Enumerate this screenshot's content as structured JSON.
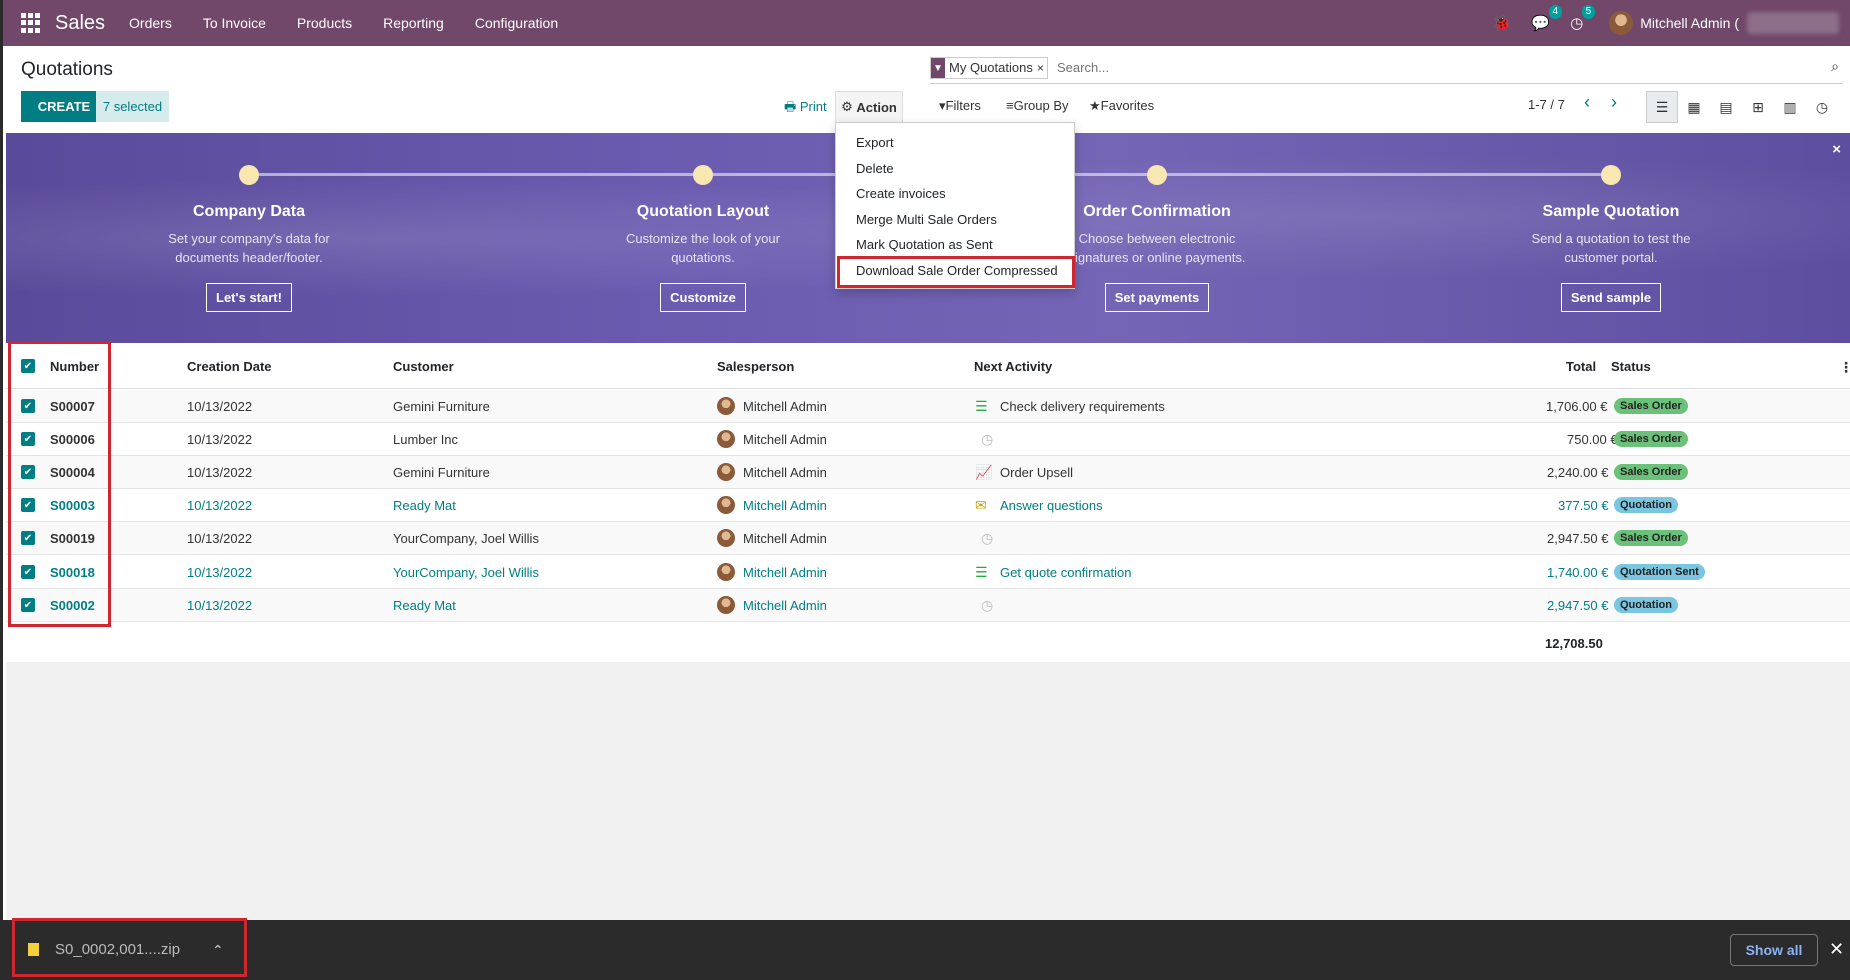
{
  "app": {
    "name": "Sales",
    "menu": [
      "Orders",
      "To Invoice",
      "Products",
      "Reporting",
      "Configuration"
    ]
  },
  "nav": {
    "messages_count": "4",
    "activities_count": "5",
    "user_name": "Mitchell Admin ("
  },
  "page": {
    "title": "Quotations",
    "create_label": "CREATE",
    "selected_label": "7 selected",
    "print_label": "Print",
    "action_label": "Action"
  },
  "action_menu": [
    "Export",
    "Delete",
    "Create invoices",
    "Merge Multi Sale Orders",
    "Mark Quotation as Sent",
    "Download Sale Order Compressed"
  ],
  "search": {
    "facet": "My Quotations",
    "placeholder": "Search..."
  },
  "filters": {
    "filters_label": "Filters",
    "groupby_label": "Group By",
    "favorites_label": "Favorites"
  },
  "pager": "1-7 / 7",
  "banner": {
    "steps": [
      {
        "title": "Company Data",
        "desc": "Set your company's data for documents header/footer.",
        "button": "Let's start!"
      },
      {
        "title": "Quotation Layout",
        "desc": "Customize the look of your quotations.",
        "button": "Customize"
      },
      {
        "title": "Order Confirmation",
        "desc": "Choose between electronic signatures or online payments.",
        "button": "Set payments"
      },
      {
        "title": "Sample Quotation",
        "desc": "Send a quotation to test the customer portal.",
        "button": "Send sample"
      }
    ]
  },
  "table": {
    "headers": {
      "number": "Number",
      "date": "Creation Date",
      "customer": "Customer",
      "salesperson": "Salesperson",
      "activity": "Next Activity",
      "total": "Total",
      "status": "Status"
    },
    "rows": [
      {
        "number": "S00007",
        "date": "10/13/2022",
        "customer": "Gemini Furniture",
        "salesperson": "Mitchell Admin",
        "activity": "Check delivery requirements",
        "activity_icon": "list-icon",
        "total": "1,706.00 €",
        "status": "Sales Order"
      },
      {
        "number": "S00006",
        "date": "10/13/2022",
        "customer": "Lumber Inc",
        "salesperson": "Mitchell Admin",
        "activity": "",
        "activity_icon": "clock-icon",
        "total": "750.00 €",
        "status": "Sales Order"
      },
      {
        "number": "S00004",
        "date": "10/13/2022",
        "customer": "Gemini Furniture",
        "salesperson": "Mitchell Admin",
        "activity": "Order Upsell",
        "activity_icon": "chart-icon",
        "total": "2,240.00 €",
        "status": "Sales Order"
      },
      {
        "number": "S00003",
        "date": "10/13/2022",
        "customer": "Ready Mat",
        "salesperson": "Mitchell Admin",
        "activity": "Answer questions",
        "activity_icon": "envelope-icon",
        "total": "377.50 €",
        "status": "Quotation"
      },
      {
        "number": "S00019",
        "date": "10/13/2022",
        "customer": "YourCompany, Joel Willis",
        "salesperson": "Mitchell Admin",
        "activity": "",
        "activity_icon": "clock-icon",
        "total": "2,947.50 €",
        "status": "Sales Order"
      },
      {
        "number": "S00018",
        "date": "10/13/2022",
        "customer": "YourCompany, Joel Willis",
        "salesperson": "Mitchell Admin",
        "activity": "Get quote confirmation",
        "activity_icon": "list-icon",
        "total": "1,740.00 €",
        "status": "Quotation Sent"
      },
      {
        "number": "S00002",
        "date": "10/13/2022",
        "customer": "Ready Mat",
        "salesperson": "Mitchell Admin",
        "activity": "",
        "activity_icon": "clock-icon",
        "total": "2,947.50 €",
        "status": "Quotation"
      }
    ],
    "grand_total": "12,708.50"
  },
  "download": {
    "file_name": "S0_0002,001....zip",
    "show_all_label": "Show all"
  },
  "colors": {
    "navbar": "#71476a",
    "primary": "#017e84",
    "highlight": "#d0262f",
    "sales_order_badge": "#6cc17a",
    "quotation_badge": "#7ac6e0"
  }
}
